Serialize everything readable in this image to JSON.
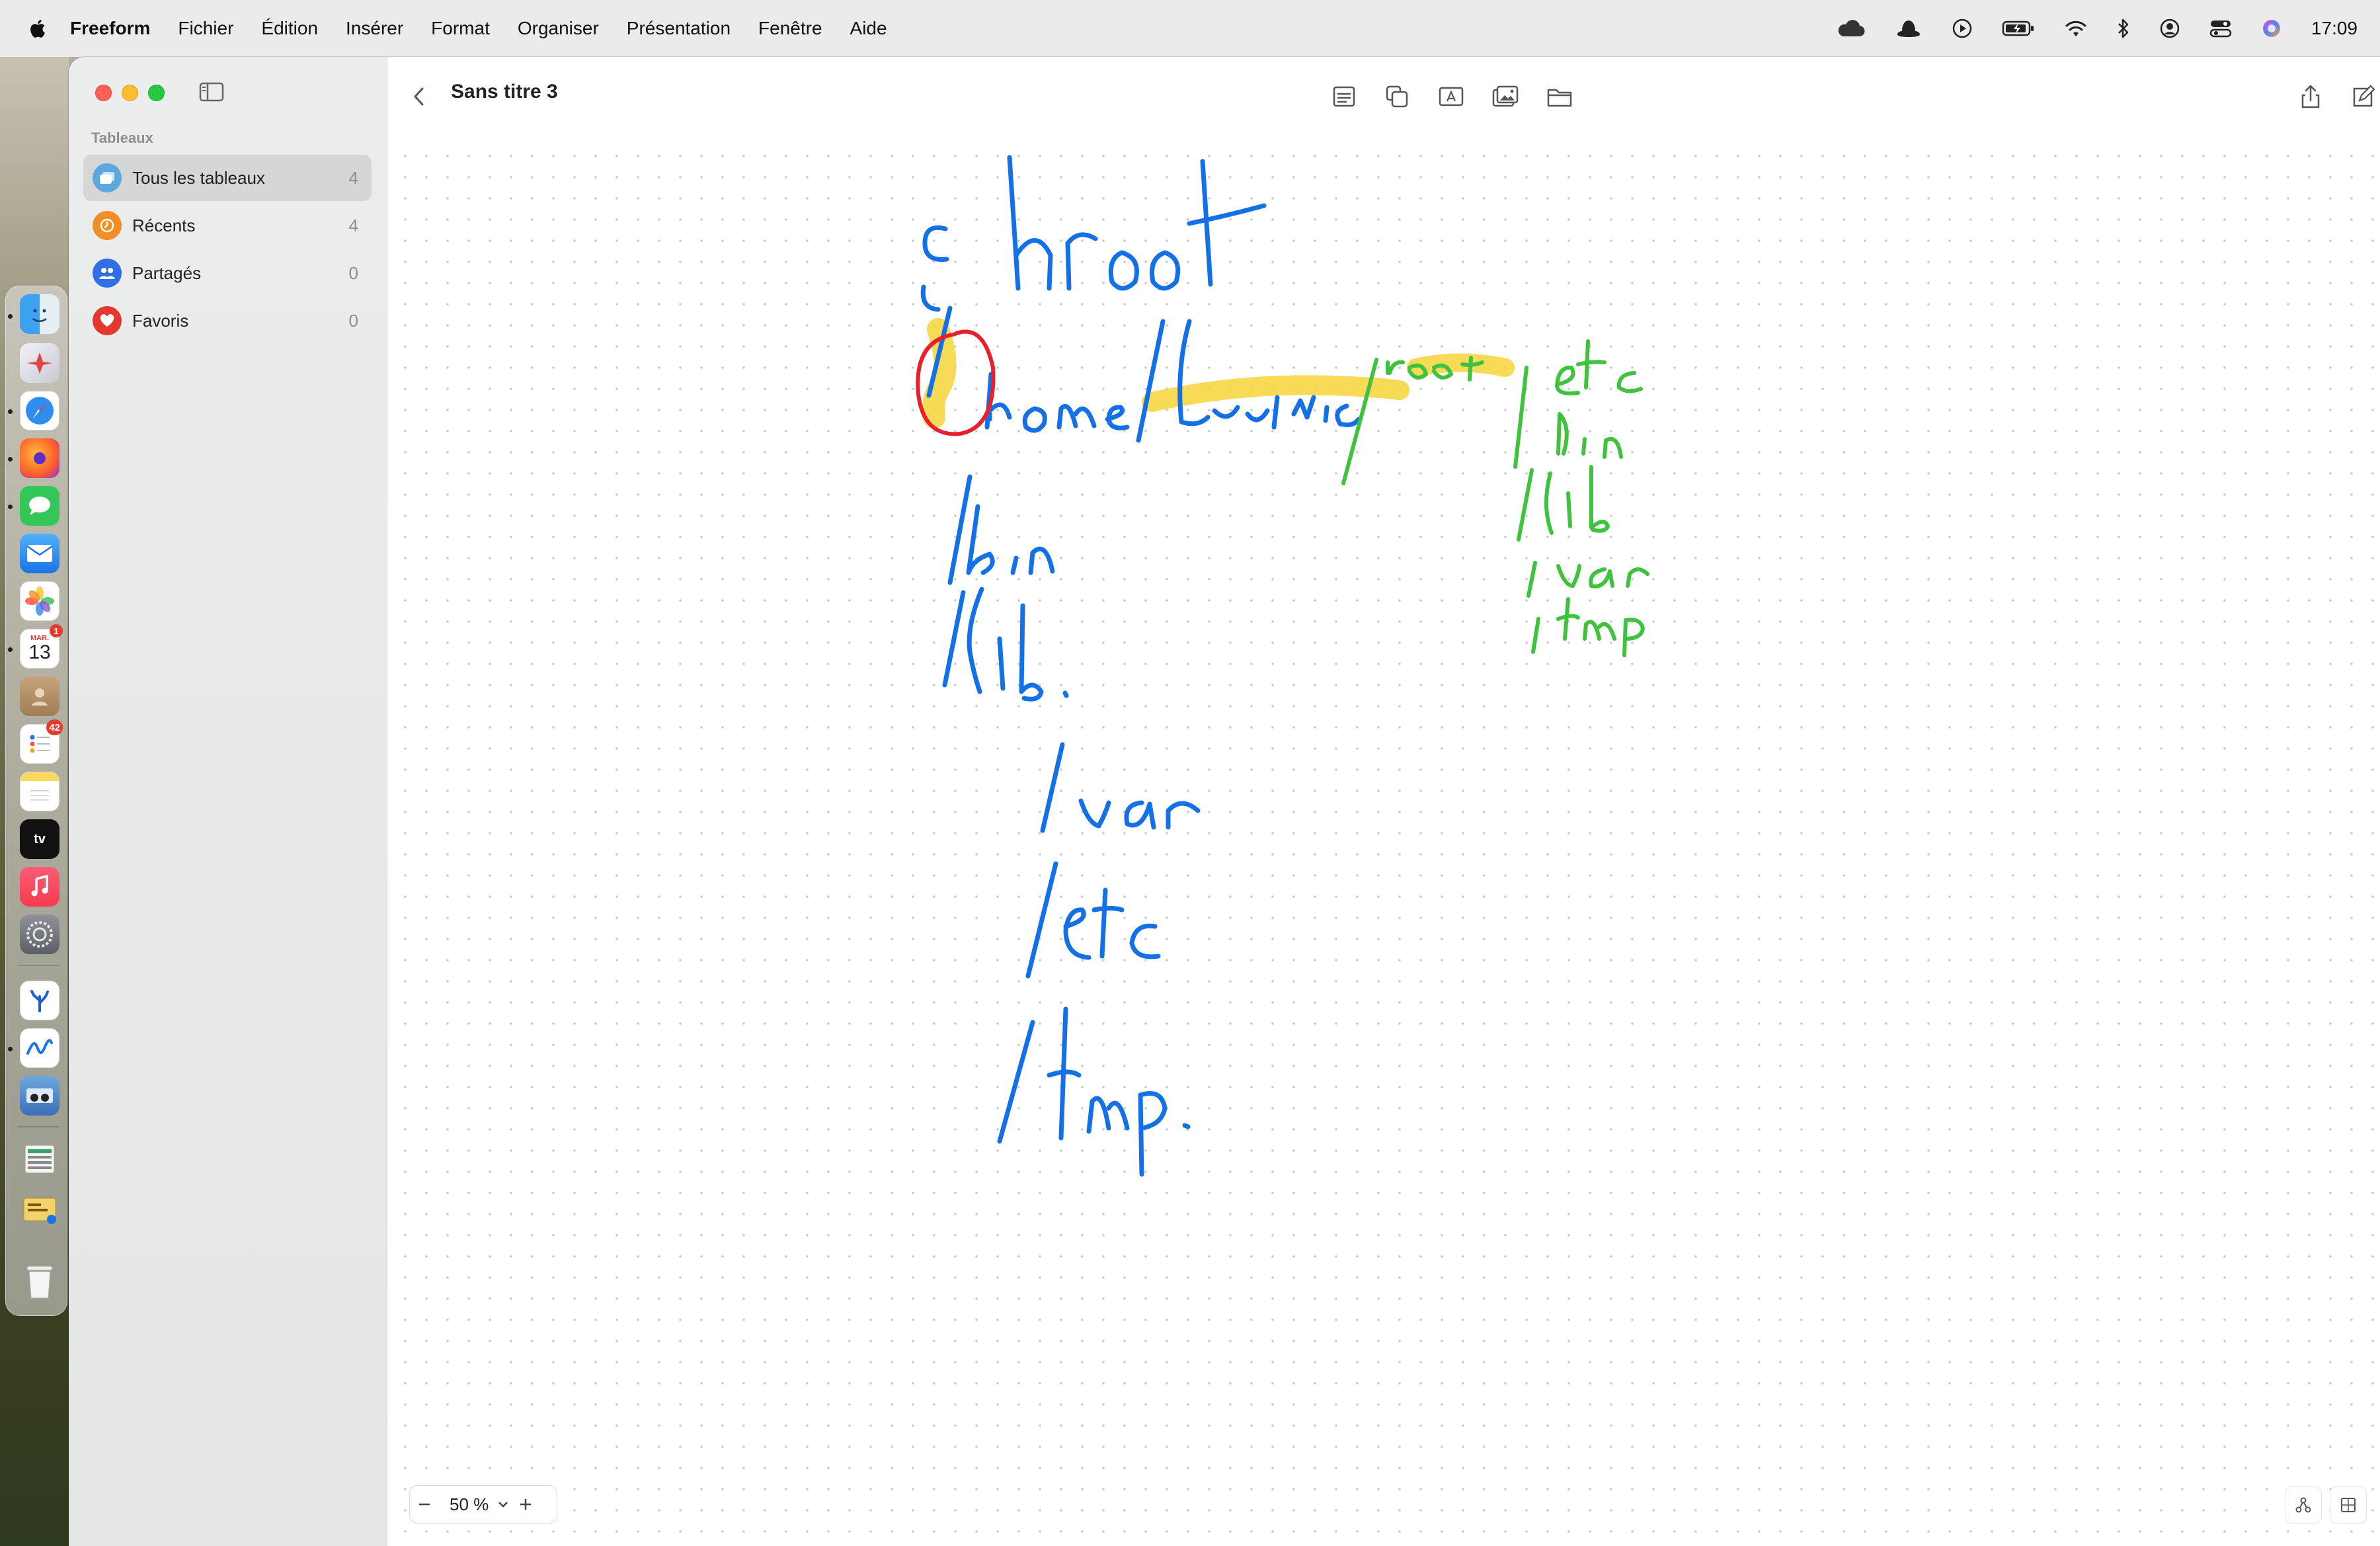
{
  "menubar": {
    "app_name": "Freeform",
    "menus": [
      "Fichier",
      "Édition",
      "Insérer",
      "Format",
      "Organiser",
      "Présentation",
      "Fenêtre",
      "Aide"
    ],
    "clock": "17:09",
    "status_icons": [
      "cloud-icon",
      "hat-icon",
      "play-icon",
      "battery-icon",
      "wifi-icon",
      "bluetooth-icon",
      "user-icon",
      "control-center-icon",
      "siri-icon"
    ]
  },
  "dock": {
    "apps": [
      "finder",
      "launchpad",
      "safari",
      "firefox",
      "messages",
      "mail",
      "photos",
      "calendar",
      "contacts",
      "reminders",
      "notes",
      "apple-tv",
      "music",
      "system-settings",
      "app-1",
      "freeform",
      "app-2",
      "app-3",
      "app-4",
      "trash"
    ],
    "calendar_month": "MAR.",
    "calendar_day": "13",
    "calendar_badge": "1",
    "reminders_badge": "42"
  },
  "sidebar": {
    "section_label": "Tableaux",
    "items": [
      {
        "label": "Tous les tableaux",
        "count": "4",
        "color": "#5ba7e0"
      },
      {
        "label": "Récents",
        "count": "4",
        "color": "#ef8f25"
      },
      {
        "label": "Partagés",
        "count": "0",
        "color": "#2f6ee4"
      },
      {
        "label": "Favoris",
        "count": "0",
        "color": "#e2382f"
      }
    ]
  },
  "board": {
    "title": "Sans titre 3",
    "zoom": "50 %",
    "handwritten_blue": [
      "chroot",
      "/home",
      "/Ludovic",
      "/bin",
      "/lib.",
      "/var",
      "/etc",
      "/tmp."
    ],
    "handwritten_green": [
      "/root",
      "/etc",
      "/bin",
      "/lib",
      "/var",
      "/tmp"
    ],
    "colors": {
      "blue_ink": "#1470e6",
      "green_ink": "#3fc23d",
      "red_ink": "#e7202c",
      "highlighter": "#f6d338",
      "accent": "#2f6ee4"
    }
  }
}
